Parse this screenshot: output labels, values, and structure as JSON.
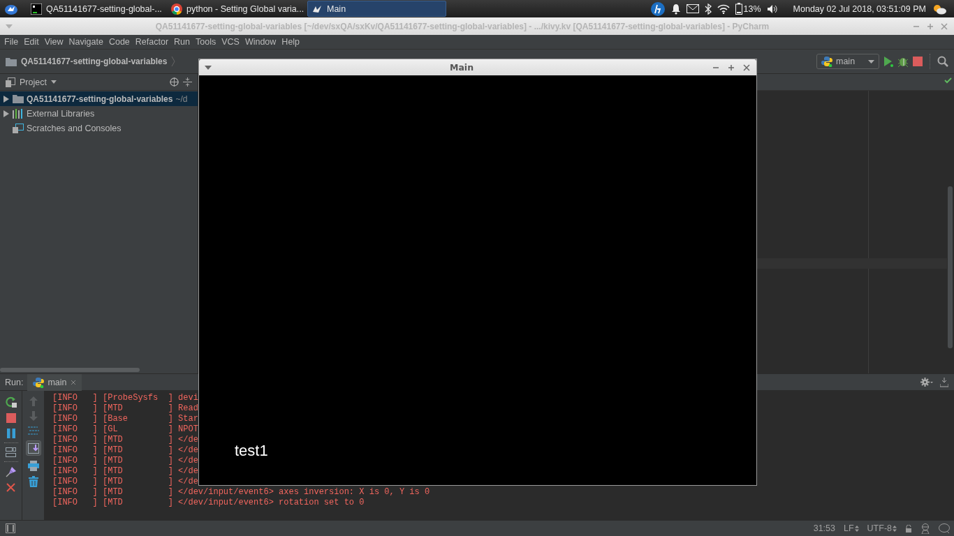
{
  "taskbar": {
    "apps": [
      {
        "kind": "pycharm",
        "label": "QA51141677-setting-global-...",
        "selected": false
      },
      {
        "kind": "chrome",
        "label": "python - Setting Global varia...",
        "selected": false
      },
      {
        "kind": "kivy",
        "label": "Main",
        "selected": true
      }
    ],
    "battery": "13%",
    "clock": "Monday 02 Jul 2018, 03:51:09 PM"
  },
  "ide": {
    "title": "QA51141677-setting-global-variables [~/dev/sxQA/sxKv/QA51141677-setting-global-variables] - .../kivy.kv [QA51141677-setting-global-variables] - PyCharm",
    "menu": [
      "File",
      "Edit",
      "View",
      "Navigate",
      "Code",
      "Refactor",
      "Run",
      "Tools",
      "VCS",
      "Window",
      "Help"
    ],
    "breadcrumb": "QA51141677-setting-global-variables",
    "run_config": "main",
    "project_panel": {
      "title": "Project",
      "tree": [
        {
          "kind": "folder",
          "label": "QA51141677-setting-global-variables",
          "path": "~/d",
          "selected": true
        },
        {
          "kind": "library",
          "label": "External Libraries",
          "selected": false
        },
        {
          "kind": "scratches",
          "label": "Scratches and Consoles",
          "selected": false
        }
      ]
    },
    "run_panel": {
      "label": "Run:",
      "tab": "main",
      "console": [
        "[INFO   ] [ProbeSysfs  ] devi",
        "[INFO   ] [MTD         ] Read",
        "[INFO   ] [Base        ] Star",
        "[INFO   ] [GL          ] NPOT",
        "[INFO   ] [MTD         ] </de",
        "[INFO   ] [MTD         ] </de",
        "[INFO   ] [MTD         ] </de",
        "[INFO   ] [MTD         ] </de",
        "[INFO   ] [MTD         ] </de",
        "[INFO   ] [MTD         ] </dev/input/event6> axes inversion: X is 0, Y is 0",
        "[INFO   ] [MTD         ] </dev/input/event6> rotation set to 0"
      ]
    },
    "status_bar": {
      "position": "31:53",
      "line_ending": "LF",
      "encoding": "UTF-8"
    }
  },
  "app_window": {
    "title": "Main",
    "label": "test1"
  }
}
